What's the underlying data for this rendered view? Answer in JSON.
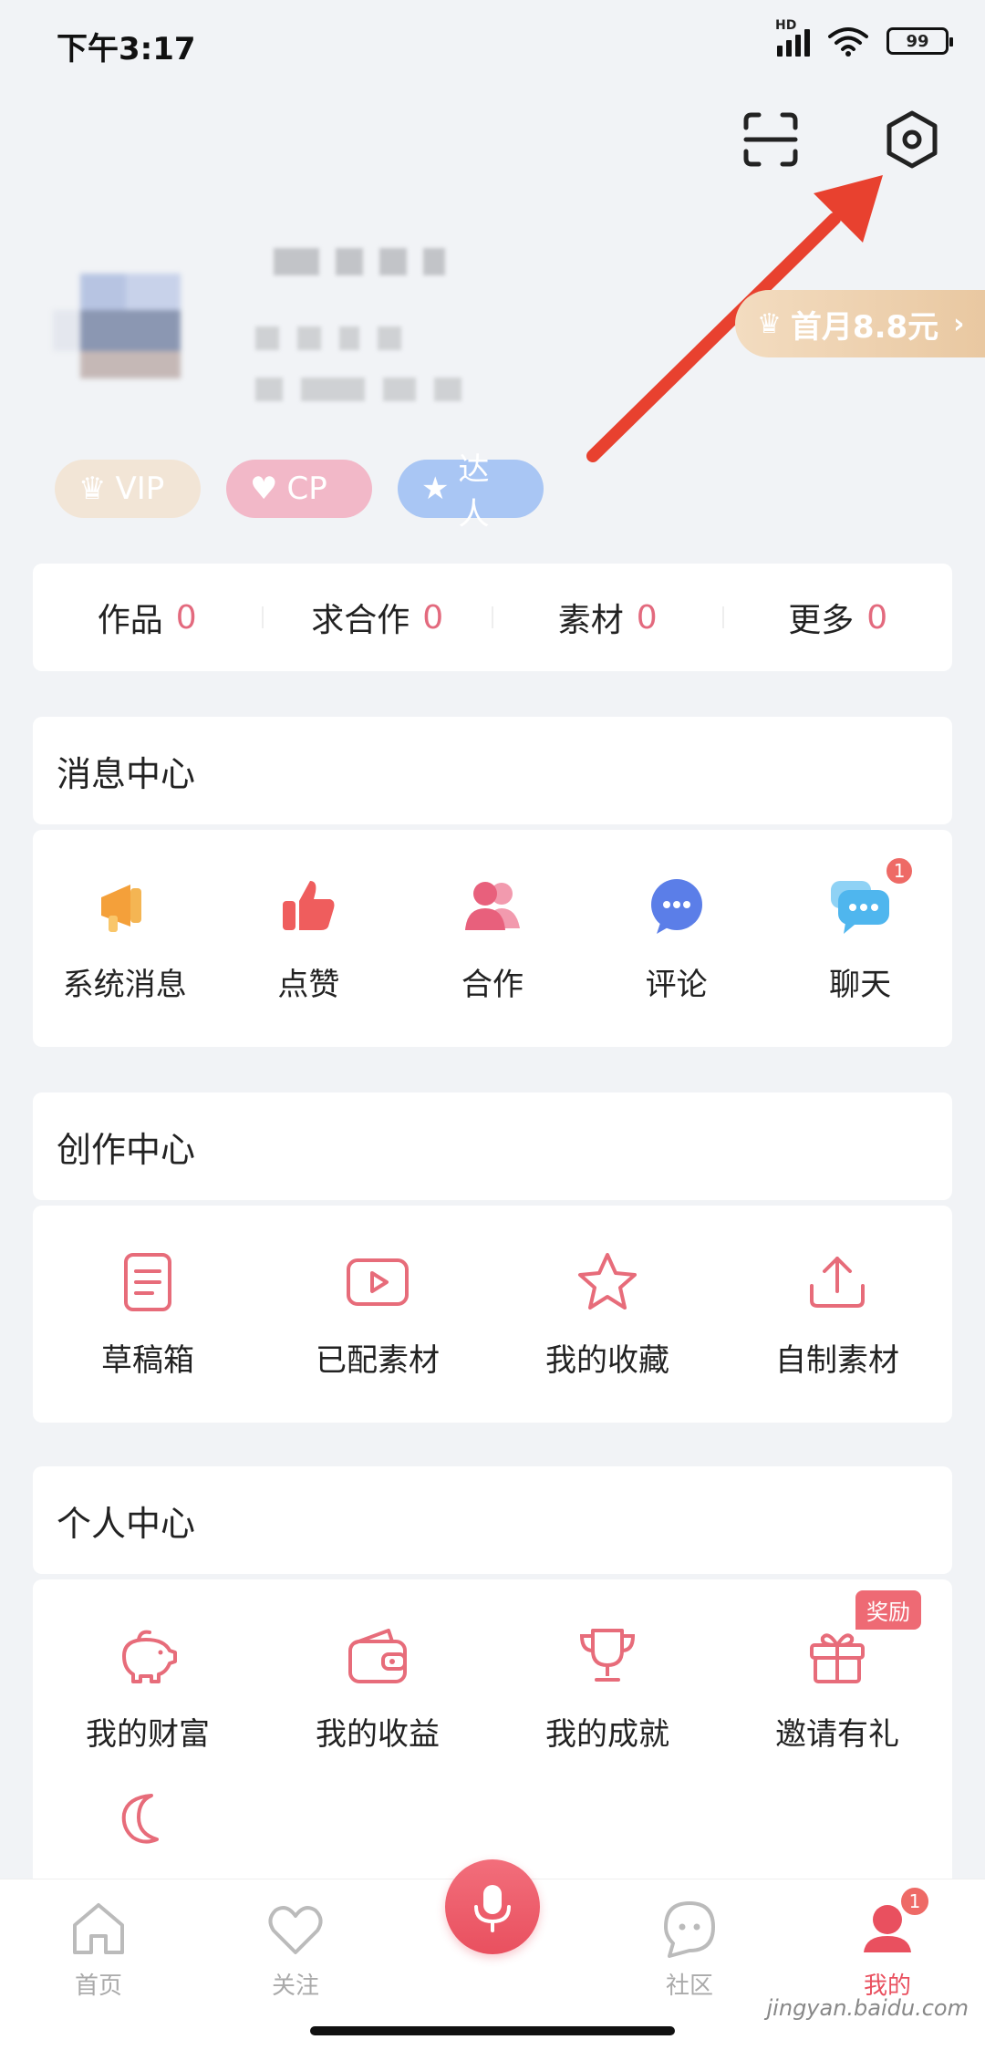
{
  "status_bar": {
    "time": "下午3:17",
    "hd": "HD",
    "battery": "99"
  },
  "promo": {
    "label": "首月8.8元"
  },
  "badges": [
    {
      "label": "VIP"
    },
    {
      "label": "CP"
    },
    {
      "label": "达人"
    }
  ],
  "stats": [
    {
      "label": "作品",
      "count": "0"
    },
    {
      "label": "求合作",
      "count": "0"
    },
    {
      "label": "素材",
      "count": "0"
    },
    {
      "label": "更多",
      "count": "0"
    }
  ],
  "message_center": {
    "title": "消息中心",
    "items": [
      {
        "label": "系统消息",
        "icon": "megaphone-icon"
      },
      {
        "label": "点赞",
        "icon": "thumbs-up-icon"
      },
      {
        "label": "合作",
        "icon": "people-icon"
      },
      {
        "label": "评论",
        "icon": "comment-icon"
      },
      {
        "label": "聊天",
        "icon": "chat-icon",
        "badge": "1"
      }
    ]
  },
  "creation_center": {
    "title": "创作中心",
    "items": [
      {
        "label": "草稿箱",
        "icon": "document-icon"
      },
      {
        "label": "已配素材",
        "icon": "video-icon"
      },
      {
        "label": "我的收藏",
        "icon": "star-icon"
      },
      {
        "label": "自制素材",
        "icon": "upload-icon"
      }
    ]
  },
  "personal_center": {
    "title": "个人中心",
    "items": [
      {
        "label": "我的财富",
        "icon": "piggy-bank-icon"
      },
      {
        "label": "我的收益",
        "icon": "wallet-icon"
      },
      {
        "label": "我的成就",
        "icon": "trophy-icon"
      },
      {
        "label": "邀请有礼",
        "icon": "gift-icon",
        "tag": "奖励"
      }
    ]
  },
  "bottom_nav": [
    {
      "label": "首页",
      "icon": "home-icon"
    },
    {
      "label": "关注",
      "icon": "heart-icon"
    },
    {
      "label": "",
      "icon": "microphone-icon"
    },
    {
      "label": "社区",
      "icon": "community-icon"
    },
    {
      "label": "我的",
      "icon": "profile-icon",
      "badge": "1"
    }
  ],
  "watermark": "jingyan.baidu.com",
  "colors": {
    "accent": "#e9505f",
    "pink": "#e36a7e",
    "annotation_arrow": "#e8412f"
  }
}
